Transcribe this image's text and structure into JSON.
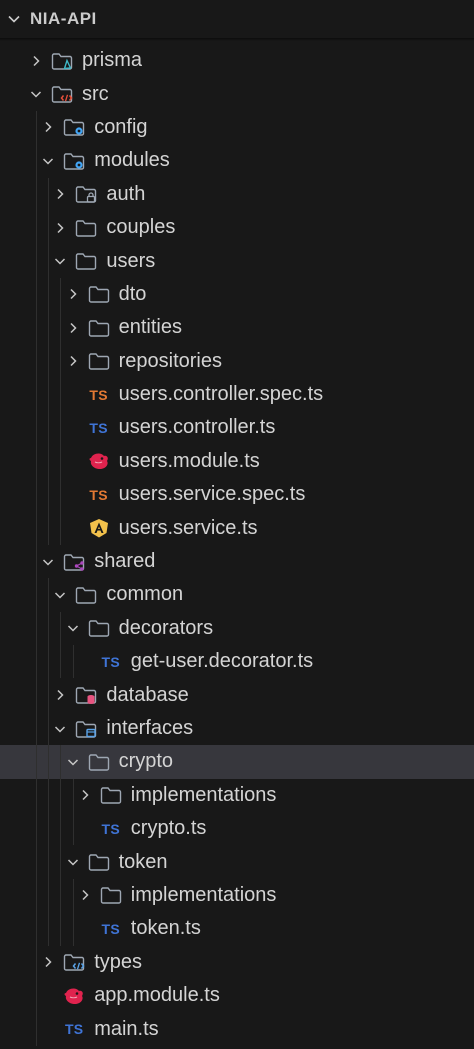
{
  "header": {
    "title": "NIA-API"
  },
  "colors": {
    "folder": "#9ea7b3",
    "ts": "#3f74d6",
    "spec": "#e37933",
    "nest": "#e0234e",
    "angular": "#f2c14b",
    "gear": "#42a5f5",
    "shared": "#ab47bc"
  },
  "tree": [
    {
      "label": "prisma",
      "depth": 1,
      "type": "folder",
      "expanded": false,
      "badge": "prisma"
    },
    {
      "label": "src",
      "depth": 1,
      "type": "folder",
      "expanded": true,
      "badge": "code-red"
    },
    {
      "label": "config",
      "depth": 2,
      "type": "folder",
      "expanded": false,
      "badge": "gear"
    },
    {
      "label": "modules",
      "depth": 2,
      "type": "folder",
      "expanded": true,
      "badge": "gear"
    },
    {
      "label": "auth",
      "depth": 3,
      "type": "folder",
      "expanded": false,
      "badge": "lock"
    },
    {
      "label": "couples",
      "depth": 3,
      "type": "folder",
      "expanded": false,
      "badge": ""
    },
    {
      "label": "users",
      "depth": 3,
      "type": "folder",
      "expanded": true,
      "badge": ""
    },
    {
      "label": "dto",
      "depth": 4,
      "type": "folder",
      "expanded": false,
      "badge": ""
    },
    {
      "label": "entities",
      "depth": 4,
      "type": "folder",
      "expanded": false,
      "badge": ""
    },
    {
      "label": "repositories",
      "depth": 4,
      "type": "folder",
      "expanded": false,
      "badge": ""
    },
    {
      "label": "users.controller.spec.ts",
      "depth": 4,
      "type": "ts-spec"
    },
    {
      "label": "users.controller.ts",
      "depth": 4,
      "type": "ts"
    },
    {
      "label": "users.module.ts",
      "depth": 4,
      "type": "nest"
    },
    {
      "label": "users.service.spec.ts",
      "depth": 4,
      "type": "ts-spec"
    },
    {
      "label": "users.service.ts",
      "depth": 4,
      "type": "angular"
    },
    {
      "label": "shared",
      "depth": 2,
      "type": "folder",
      "expanded": true,
      "badge": "share"
    },
    {
      "label": "common",
      "depth": 3,
      "type": "folder",
      "expanded": true,
      "badge": ""
    },
    {
      "label": "decorators",
      "depth": 4,
      "type": "folder",
      "expanded": true,
      "badge": ""
    },
    {
      "label": "get-user.decorator.ts",
      "depth": 5,
      "type": "ts"
    },
    {
      "label": "database",
      "depth": 3,
      "type": "folder",
      "expanded": false,
      "badge": "database"
    },
    {
      "label": "interfaces",
      "depth": 3,
      "type": "folder",
      "expanded": true,
      "badge": "interface"
    },
    {
      "label": "crypto",
      "depth": 4,
      "type": "folder",
      "expanded": true,
      "badge": "",
      "selected": true
    },
    {
      "label": "implementations",
      "depth": 5,
      "type": "folder",
      "expanded": false,
      "badge": ""
    },
    {
      "label": "crypto.ts",
      "depth": 5,
      "type": "ts"
    },
    {
      "label": "token",
      "depth": 4,
      "type": "folder",
      "expanded": true,
      "badge": ""
    },
    {
      "label": "implementations",
      "depth": 5,
      "type": "folder",
      "expanded": false,
      "badge": ""
    },
    {
      "label": "token.ts",
      "depth": 5,
      "type": "ts"
    },
    {
      "label": "types",
      "depth": 2,
      "type": "folder",
      "expanded": false,
      "badge": "code-blue"
    },
    {
      "label": "app.module.ts",
      "depth": 2,
      "type": "nest"
    },
    {
      "label": "main.ts",
      "depth": 2,
      "type": "ts"
    }
  ],
  "glyphs": {
    "ts": "TS"
  }
}
